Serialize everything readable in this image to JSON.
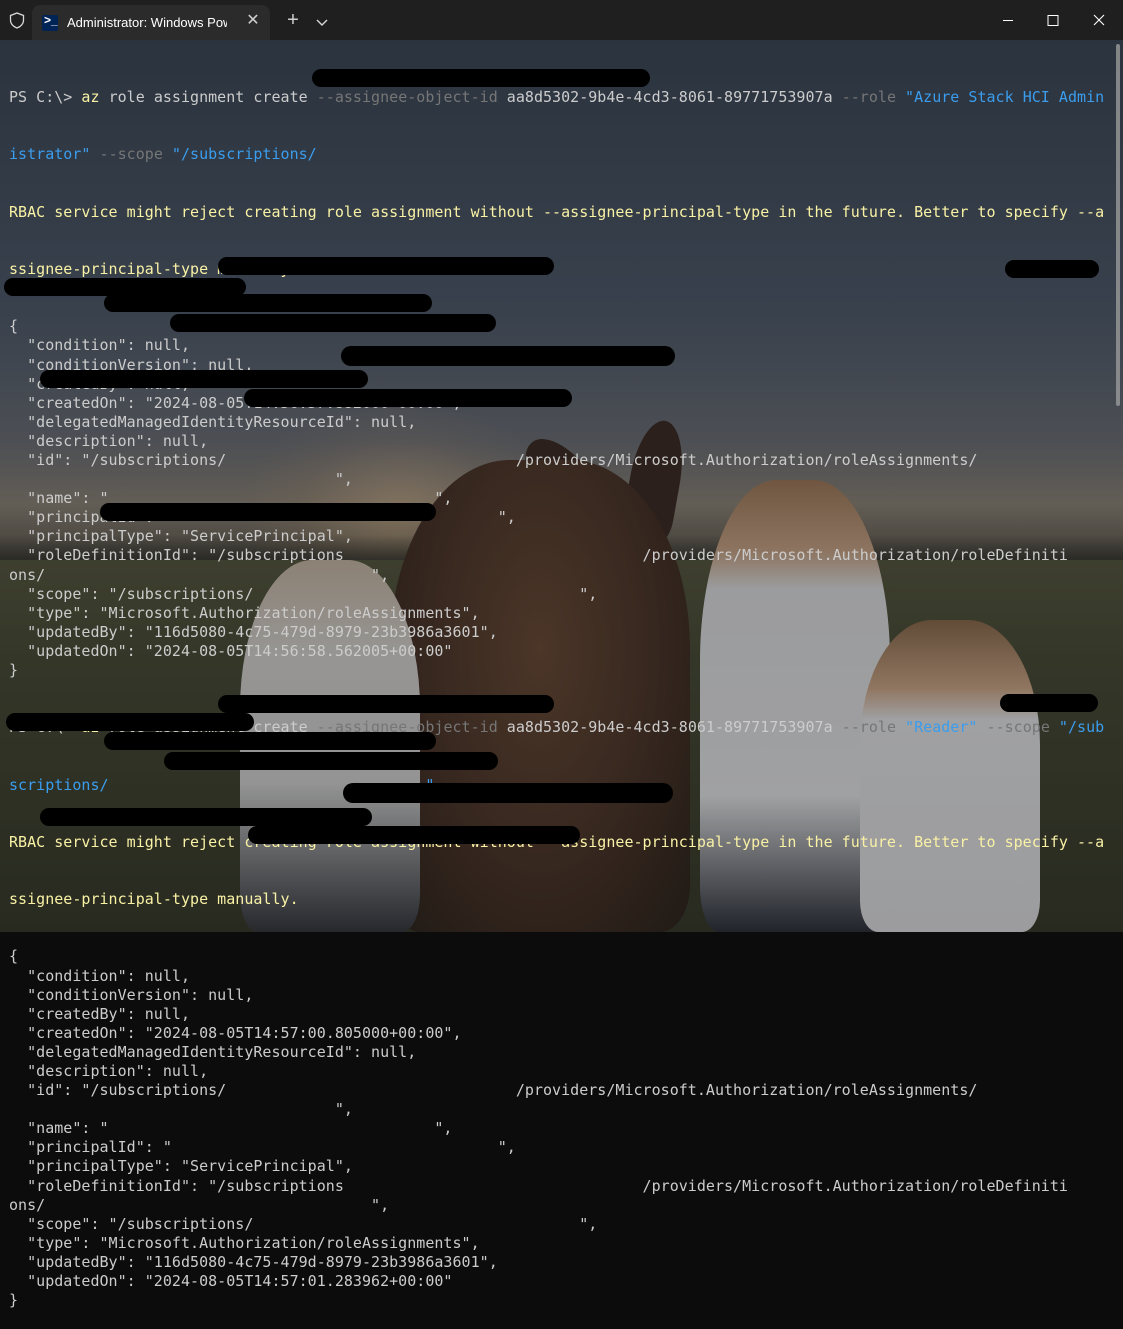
{
  "window": {
    "tab_title": "Administrator: Windows Powe",
    "tab_close_glyph": "✕",
    "new_tab_glyph": "+"
  },
  "colors": {
    "prompt": "#cccccc",
    "command": "#f9f1a5",
    "parameter": "#767676",
    "string": "#3b9ded",
    "warning": "#f9f1a5",
    "output": "#cccccc"
  },
  "icons": [
    "shield-icon",
    "powershell-icon",
    "close-icon",
    "plus-icon",
    "chevron-down-icon",
    "minimize-icon",
    "maximize-icon",
    "window-close-icon"
  ],
  "terminal": {
    "cmd1": {
      "prompt": "PS C:\\> ",
      "verb": "az",
      "rest": " role assignment create ",
      "p1": "--assignee-object-id",
      "v1": " aa8d5302-9b4e-4cd3-8061-89771753907a ",
      "p2": "--role",
      "v2a": " \"Azure Stack HCI Admin",
      "v2b": "istrator\"",
      "p3": " --scope",
      "v3": " \"/subscriptions/"
    },
    "warn1a": "RBAC service might reject creating role assignment without --assignee-principal-type in the future. Better to specify --a",
    "warn1b": "ssignee-principal-type manually.",
    "out1": [
      "{",
      "  \"condition\": null,",
      "  \"conditionVersion\": null,",
      "  \"createdBy\": null,",
      "  \"createdOn\": \"2024-08-05T14:56:57.882000+00:00\",",
      "  \"delegatedManagedIdentityResourceId\": null,",
      "  \"description\": null,",
      "  \"id\": \"/subscriptions/                                /providers/Microsoft.Authorization/roleAssignments/",
      "                                    \",",
      "  \"name\": \"                                    \",",
      "  \"principalId\": \"                                    \",",
      "  \"principalType\": \"ServicePrincipal\",",
      "  \"roleDefinitionId\": \"/subscriptions                                 /providers/Microsoft.Authorization/roleDefiniti",
      "ons/                                    \",",
      "  \"scope\": \"/subscriptions/                                    \",",
      "  \"type\": \"Microsoft.Authorization/roleAssignments\",",
      "  \"updatedBy\": \"116d5080-4c75-479d-8979-23b3986a3601\",",
      "  \"updatedOn\": \"2024-08-05T14:56:58.562005+00:00\"",
      "}"
    ],
    "cmd2": {
      "prompt": "PS C:\\> ",
      "verb": "az",
      "rest": " role assignment create ",
      "p1": "--assignee-object-id",
      "v1": " aa8d5302-9b4e-4cd3-8061-89771753907a ",
      "p2": "--role",
      "v2a": " \"Reader\"",
      "p3": " --scope",
      "v3a": " \"/sub",
      "v3b": "scriptions/                                   \""
    },
    "warn2a": "RBAC service might reject creating role assignment without --assignee-principal-type in the future. Better to specify --a",
    "warn2b": "ssignee-principal-type manually.",
    "out2": [
      "{",
      "  \"condition\": null,",
      "  \"conditionVersion\": null,",
      "  \"createdBy\": null,",
      "  \"createdOn\": \"2024-08-05T14:57:00.805000+00:00\",",
      "  \"delegatedManagedIdentityResourceId\": null,",
      "  \"description\": null,",
      "  \"id\": \"/subscriptions/                                /providers/Microsoft.Authorization/roleAssignments/",
      "                                    \",",
      "  \"name\": \"                                    \",",
      "  \"principalId\": \"                                    \",",
      "  \"principalType\": \"ServicePrincipal\",",
      "  \"roleDefinitionId\": \"/subscriptions                                 /providers/Microsoft.Authorization/roleDefiniti",
      "ons/                                    \",",
      "  \"scope\": \"/subscriptions/                                    \",",
      "  \"type\": \"Microsoft.Authorization/roleAssignments\",",
      "  \"updatedBy\": \"116d5080-4c75-479d-8979-23b3986a3601\",",
      "  \"updatedOn\": \"2024-08-05T14:57:01.283962+00:00\"",
      "}"
    ]
  }
}
